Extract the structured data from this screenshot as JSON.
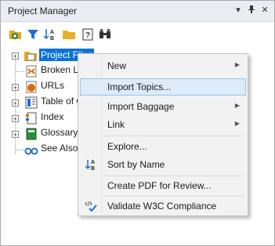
{
  "panel": {
    "title": "Project Manager",
    "title_buttons": [
      "▾",
      "ᵖ",
      "✕"
    ]
  },
  "toolbar": {
    "tools": [
      {
        "name": "add-folder-icon",
        "color": "#e0a100"
      },
      {
        "name": "filter-icon",
        "color": "#1f6fd1"
      },
      {
        "name": "sort-icon",
        "color": "#333333"
      },
      {
        "name": "folder-icon",
        "color": "#e7b02b"
      },
      {
        "name": "help-icon",
        "color": "#333333"
      },
      {
        "name": "find-icon",
        "color": "#333333"
      }
    ]
  },
  "tree": {
    "items": [
      {
        "label": "Project Files",
        "icon": "project-files-icon",
        "expandable": true,
        "selected": true
      },
      {
        "label": "Broken Li",
        "icon": "broken-links-icon",
        "expandable": false,
        "selected": false
      },
      {
        "label": "URLs",
        "icon": "urls-icon",
        "expandable": true,
        "selected": false
      },
      {
        "label": "Table of C",
        "icon": "table-of-contents-icon",
        "expandable": true,
        "selected": false
      },
      {
        "label": "Index",
        "icon": "index-icon",
        "expandable": true,
        "selected": false
      },
      {
        "label": "Glossary",
        "icon": "glossary-icon",
        "expandable": true,
        "selected": false
      },
      {
        "label": "See Also",
        "icon": "see-also-icon",
        "expandable": false,
        "selected": false
      }
    ]
  },
  "context_menu": {
    "items": [
      {
        "label": "New",
        "submenu": true
      },
      {
        "label": "Import Topics...",
        "submenu": false,
        "hover": true
      },
      {
        "label": "Import Baggage",
        "submenu": true
      },
      {
        "label": "Link",
        "submenu": true
      },
      {
        "label": "Explore...",
        "submenu": false
      },
      {
        "label": "Sort by Name",
        "submenu": false,
        "icon": "sort-az-icon"
      },
      {
        "label": "Create PDF for Review...",
        "submenu": false
      },
      {
        "label": "Validate W3C Compliance",
        "submenu": false,
        "icon": "validate-icon"
      }
    ]
  },
  "colors": {
    "selection": "#0b73d6",
    "menu_hover": "#ddeaf8",
    "titlebar": "#e9edf3"
  }
}
